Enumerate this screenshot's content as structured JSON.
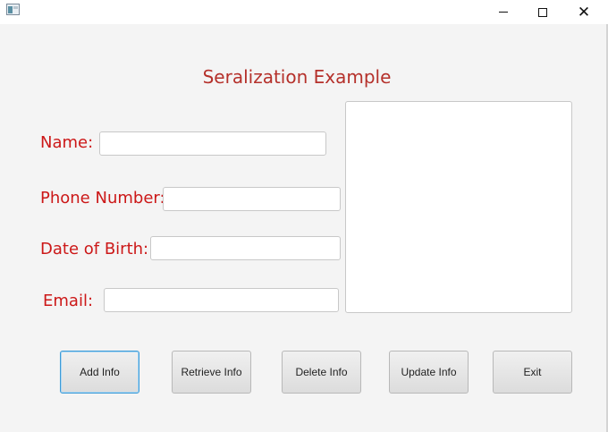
{
  "window": {
    "controls": {
      "minimize": "—",
      "maximize": "□",
      "close": "✕"
    }
  },
  "form": {
    "title": "Seralization Example",
    "fields": {
      "name": {
        "label": "Name:",
        "value": ""
      },
      "phone": {
        "label": "Phone Number:",
        "value": ""
      },
      "dob": {
        "label": "Date of Birth:",
        "value": ""
      },
      "email": {
        "label": "Email:",
        "value": ""
      }
    },
    "output": {
      "value": ""
    }
  },
  "buttons": {
    "add": "Add Info",
    "retrieve": "Retrieve Info",
    "delete": "Delete Info",
    "update": "Update Info",
    "exit": "Exit"
  },
  "colors": {
    "label": "#cc1818",
    "title": "#b5312b",
    "focus": "#3c9ad6"
  },
  "icons": {
    "app": "java-app-icon",
    "minimize": "minimize-icon",
    "maximize": "maximize-icon",
    "close": "close-icon"
  }
}
